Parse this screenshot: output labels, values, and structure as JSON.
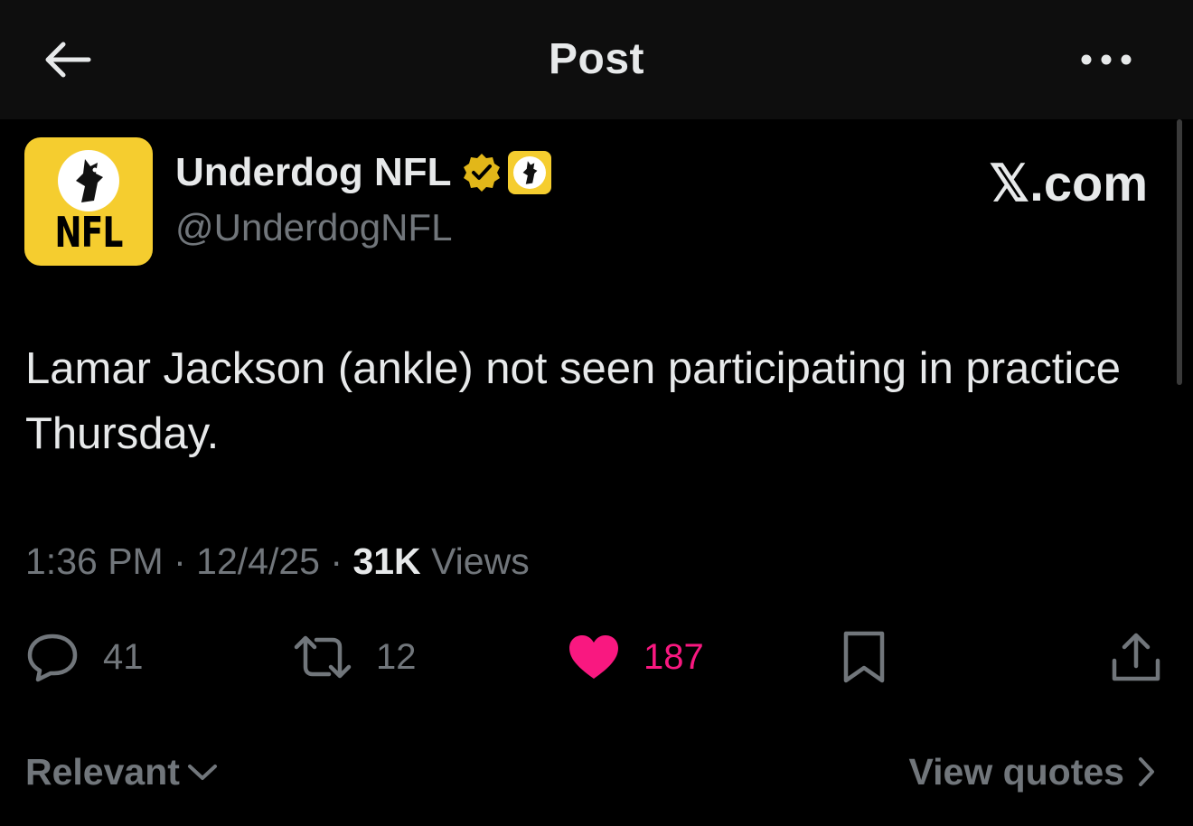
{
  "header": {
    "title": "Post",
    "back_icon": "arrow-left-icon",
    "more_icon": "more-horizontal-icon"
  },
  "author": {
    "name": "Underdog NFL",
    "handle": "@UnderdogNFL",
    "avatar_text": "NFL",
    "verified_badge_icon": "verified-badge-icon",
    "affiliate_badge_icon": "underdog-logo-icon",
    "brand_color": "#f5cd2f",
    "verified_color": "#e2b719"
  },
  "source": "𝕏.com",
  "post": {
    "text": "Lamar Jackson (ankle) not seen participating in practice Thursday."
  },
  "meta": {
    "time": "1:36 PM",
    "separator": "·",
    "date": "12/4/25",
    "views_count": "31K",
    "views_label": "Views"
  },
  "actions": {
    "replies": {
      "icon": "reply-icon",
      "count": "41"
    },
    "reposts": {
      "icon": "repost-icon",
      "count": "12"
    },
    "likes": {
      "icon": "heart-icon",
      "count": "187",
      "liked": true,
      "color": "#f91880"
    },
    "bookmark": {
      "icon": "bookmark-icon"
    },
    "share": {
      "icon": "share-icon"
    }
  },
  "footer": {
    "sort_label": "Relevant",
    "sort_icon": "chevron-down-icon",
    "quotes_label": "View quotes",
    "quotes_icon": "chevron-right-icon"
  },
  "colors": {
    "background": "#000000",
    "header_background": "#0e0e0e",
    "text_primary": "#e7e9ea",
    "text_secondary": "#71767b"
  }
}
